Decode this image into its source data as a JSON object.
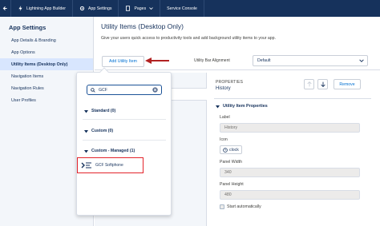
{
  "topbar": {
    "items": [
      {
        "label": "Lightning App Builder"
      },
      {
        "label": "App Settings"
      },
      {
        "label": "Pages"
      },
      {
        "label": "Service Console"
      }
    ]
  },
  "sidebar": {
    "title": "App Settings",
    "items": [
      {
        "label": "App Details & Branding"
      },
      {
        "label": "App Options"
      },
      {
        "label": "Utility Items (Desktop Only)"
      },
      {
        "label": "Navigation Items"
      },
      {
        "label": "Navigation Rules"
      },
      {
        "label": "User Profiles"
      }
    ]
  },
  "main": {
    "heading": "Utility Items (Desktop Only)",
    "description": "Give your users quick access to productivity tools and add background utility items to your app.",
    "add_button": "Add Utility Item",
    "alignment_label": "Utility Bar Alignment",
    "alignment_value": "Default"
  },
  "popover": {
    "search_value": "GCF",
    "categories": [
      {
        "label": "Standard (0)"
      },
      {
        "label": "Custom (0)"
      },
      {
        "label": "Custom - Managed (1)"
      }
    ],
    "result_label": "GCF Softphone"
  },
  "properties": {
    "title": "PROPERTIES",
    "subtitle": "History",
    "remove_button": "Remove",
    "section": "Utility Item Properties",
    "label_label": "Label",
    "label_value": "History",
    "icon_label": "Icon",
    "icon_value": "clock",
    "width_label": "Panel Width",
    "width_value": "340",
    "height_label": "Panel Height",
    "height_value": "480",
    "start_label": "Start automatically"
  },
  "colors": {
    "topbar": "#16325c",
    "accent": "#0070d2",
    "highlight": "#e3242b",
    "arrow": "#b22222"
  }
}
